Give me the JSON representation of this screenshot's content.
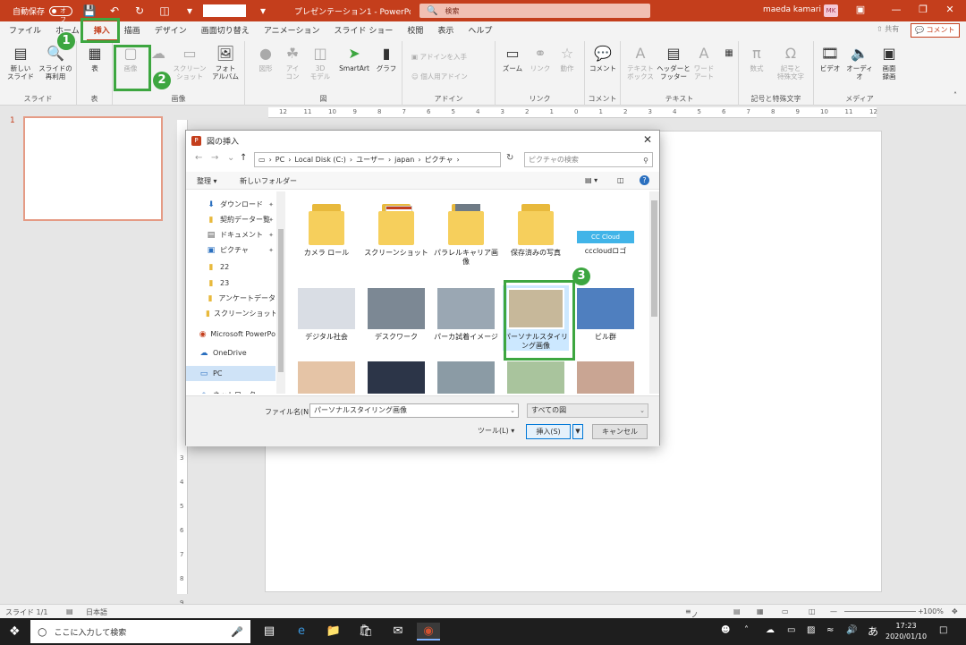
{
  "titlebar": {
    "autosave_label": "自動保存",
    "autosave_state": "オフ",
    "doc_title": "プレゼンテーション1 - PowerPo...",
    "search_placeholder": "検索",
    "user_name": "maeda kamari",
    "user_initials": "MK"
  },
  "tabs": [
    "ファイル",
    "ホーム",
    "挿入",
    "描画",
    "デザイン",
    "画面切り替え",
    "アニメーション",
    "スライド ショー",
    "校閲",
    "表示",
    "ヘルプ"
  ],
  "active_tab": "挿入",
  "ribbon_right": {
    "share": "共有",
    "comment": "コメント"
  },
  "ribbon": {
    "slide_group": {
      "label": "スライド",
      "new_slide": "新しい\nスライド",
      "reuse": "スライドの\n再利用"
    },
    "table_group": {
      "label": "表",
      "table": "表"
    },
    "image_group": {
      "label": "画像",
      "picture": "画像",
      "screenshot": "スクリーン\nショット",
      "album": "フォト\nアルバム"
    },
    "shape_group": {
      "label": "図",
      "shapes": "図形",
      "icons": "アイ\nコン",
      "models": "3D\nモデル",
      "smartart": "SmartArt",
      "chart": "グラフ"
    },
    "addin_group": {
      "label": "アドイン",
      "get": "アドインを入手",
      "personal": "個人用アドイン"
    },
    "link_group": {
      "label": "リンク",
      "zoom": "ズーム",
      "link": "リンク",
      "action": "動作"
    },
    "comment_group": {
      "label": "コメント",
      "comment": "コメント"
    },
    "text_group": {
      "label": "テキスト",
      "textbox": "テキスト\nボックス",
      "header": "ヘッダーと\nフッター",
      "wordart": "ワード\nアート"
    },
    "symbol_group": {
      "label": "記号と特殊文字",
      "equation": "数式",
      "symbol": "記号と\n特殊文字"
    },
    "media_group": {
      "label": "メディア",
      "video": "ビデオ",
      "audio": "オーディオ",
      "record": "画面\n録画"
    }
  },
  "ruler_h": [
    "12",
    "11",
    "10",
    "9",
    "8",
    "7",
    "6",
    "5",
    "4",
    "3",
    "2",
    "1",
    "0",
    "1",
    "2",
    "3",
    "4",
    "5",
    "6",
    "7",
    "8",
    "9",
    "10",
    "11",
    "12"
  ],
  "ruler_v": [
    "3",
    "4",
    "5",
    "6",
    "7",
    "8",
    "9"
  ],
  "slide_number": "1",
  "dialog": {
    "title": "図の挿入",
    "address": [
      "PC",
      "Local Disk (C:)",
      "ユーザー",
      "japan",
      "ピクチャ"
    ],
    "search_placeholder": "ピクチャの検索",
    "organize": "整理",
    "new_folder": "新しいフォルダー",
    "nav_items": [
      {
        "label": "ダウンロード",
        "icon": "download-icon",
        "pinned": true
      },
      {
        "label": "契約データー覧",
        "icon": "folder-icon",
        "pinned": true
      },
      {
        "label": "ドキュメント",
        "icon": "document-icon",
        "pinned": true
      },
      {
        "label": "ピクチャ",
        "icon": "pictures-icon",
        "pinned": true
      },
      {
        "label": "22",
        "icon": "folder-icon",
        "pinned": false
      },
      {
        "label": "23",
        "icon": "folder-icon",
        "pinned": false
      },
      {
        "label": "アンケートデータ",
        "icon": "folder-icon",
        "pinned": false
      },
      {
        "label": "スクリーンショット",
        "icon": "folder-icon",
        "pinned": false
      },
      {
        "label": "Microsoft PowerPo",
        "icon": "powerpoint-icon",
        "pinned": false
      },
      {
        "label": "OneDrive",
        "icon": "onedrive-icon",
        "pinned": false
      },
      {
        "label": "PC",
        "icon": "pc-icon",
        "pinned": false,
        "selected": true
      },
      {
        "label": "ネットワーク",
        "icon": "network-icon",
        "pinned": false
      }
    ],
    "files": [
      {
        "label": "カメラ ロール",
        "kind": "folder"
      },
      {
        "label": "スクリーンショット",
        "kind": "folder-doc"
      },
      {
        "label": "パラレルキャリア画像",
        "kind": "folder-photo"
      },
      {
        "label": "保存済みの写真",
        "kind": "folder"
      },
      {
        "label": "cccloudロゴ",
        "kind": "logo",
        "logo_text": "CC Cloud"
      },
      {
        "label": "デジタル社会",
        "kind": "photo",
        "color": "#d9dde4"
      },
      {
        "label": "デスクワーク",
        "kind": "photo",
        "color": "#7c8894"
      },
      {
        "label": "パーカ試着イメージ",
        "kind": "photo",
        "color": "#9aa7b3"
      },
      {
        "label": "パーソナルスタイリング画像",
        "kind": "photo",
        "color": "#c7b89a",
        "selected": true
      },
      {
        "label": "ビル群",
        "kind": "photo",
        "color": "#4f7fbf"
      },
      {
        "label": "",
        "kind": "photo",
        "color": "#e5c4a6"
      },
      {
        "label": "",
        "kind": "photo",
        "color": "#2c3548"
      },
      {
        "label": "",
        "kind": "photo",
        "color": "#8b9ba5"
      },
      {
        "label": "",
        "kind": "photo",
        "color": "#a9c49d"
      },
      {
        "label": "",
        "kind": "photo",
        "color": "#c9a593"
      }
    ],
    "filename_label": "ファイル名(N):",
    "filename_value": "パーソナルスタイリング画像",
    "filetype": "すべての図",
    "tools": "ツール(L)",
    "insert": "挿入(S)",
    "cancel": "キャンセル"
  },
  "status": {
    "slide": "スライド 1/1",
    "language": "日本語",
    "notes": "ノート",
    "zoom": "100%"
  },
  "taskbar": {
    "search_placeholder": "ここに入力して検索",
    "time": "17:23",
    "date": "2020/01/10",
    "ime": "あ"
  },
  "annotations": [
    "1",
    "2",
    "3"
  ],
  "colors": {
    "accent": "#c43e1c",
    "highlight": "#3da640"
  }
}
